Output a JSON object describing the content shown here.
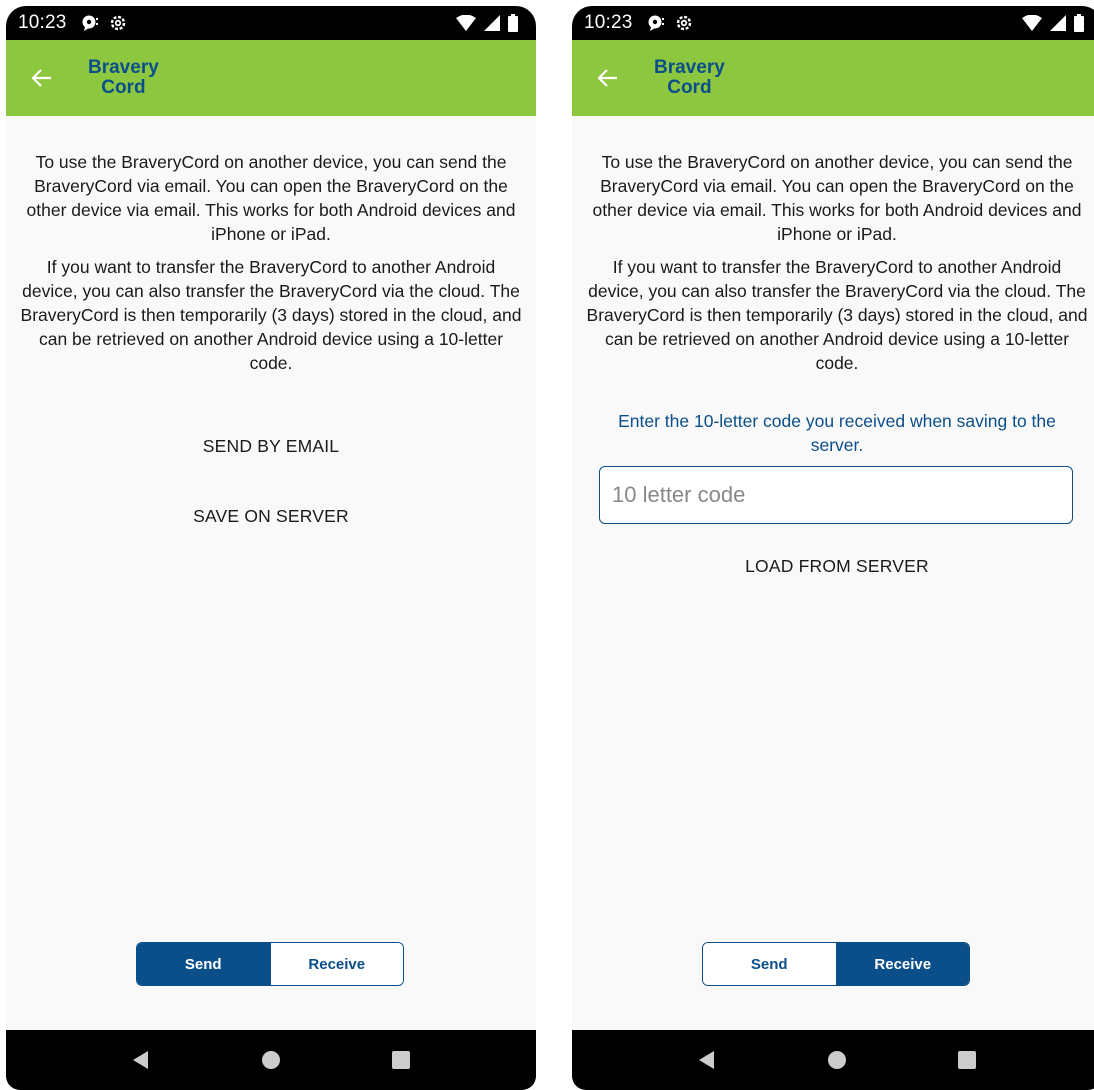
{
  "status": {
    "time": "10:23"
  },
  "app": {
    "title_line1": "Bravery",
    "title_line2": "Cord"
  },
  "text": {
    "intro": "To use the BraveryCord on another device, you can send the BraveryCord via email. You can open the BraveryCord on the other device via email. This works for both Android devices and iPhone or iPad.",
    "cloud": "If you want to transfer the BraveryCord to another Android device, you can also transfer the BraveryCord via the cloud. The BraveryCord is then temporarily (3 days) stored in the cloud, and can be retrieved on another Android device using a 10-letter code."
  },
  "send_screen": {
    "email_button": "SEND BY EMAIL",
    "server_button": "SAVE ON SERVER"
  },
  "receive_screen": {
    "hint": "Enter the 10-letter code you received when saving to the server.",
    "code_placeholder": "10 letter code",
    "code_value": "",
    "load_button": "LOAD FROM SERVER"
  },
  "segment": {
    "send": "Send",
    "receive": "Receive"
  },
  "colors": {
    "appbar": "#8dc63f",
    "accent": "#0b4f8a",
    "background": "#f9f9f9"
  },
  "icons": {
    "status_left": [
      "chat-notification-icon",
      "settings-icon"
    ],
    "status_right": [
      "wifi-icon",
      "signal-icon",
      "battery-icon"
    ],
    "nav": [
      "back-triangle-icon",
      "home-circle-icon",
      "recents-square-icon"
    ]
  }
}
